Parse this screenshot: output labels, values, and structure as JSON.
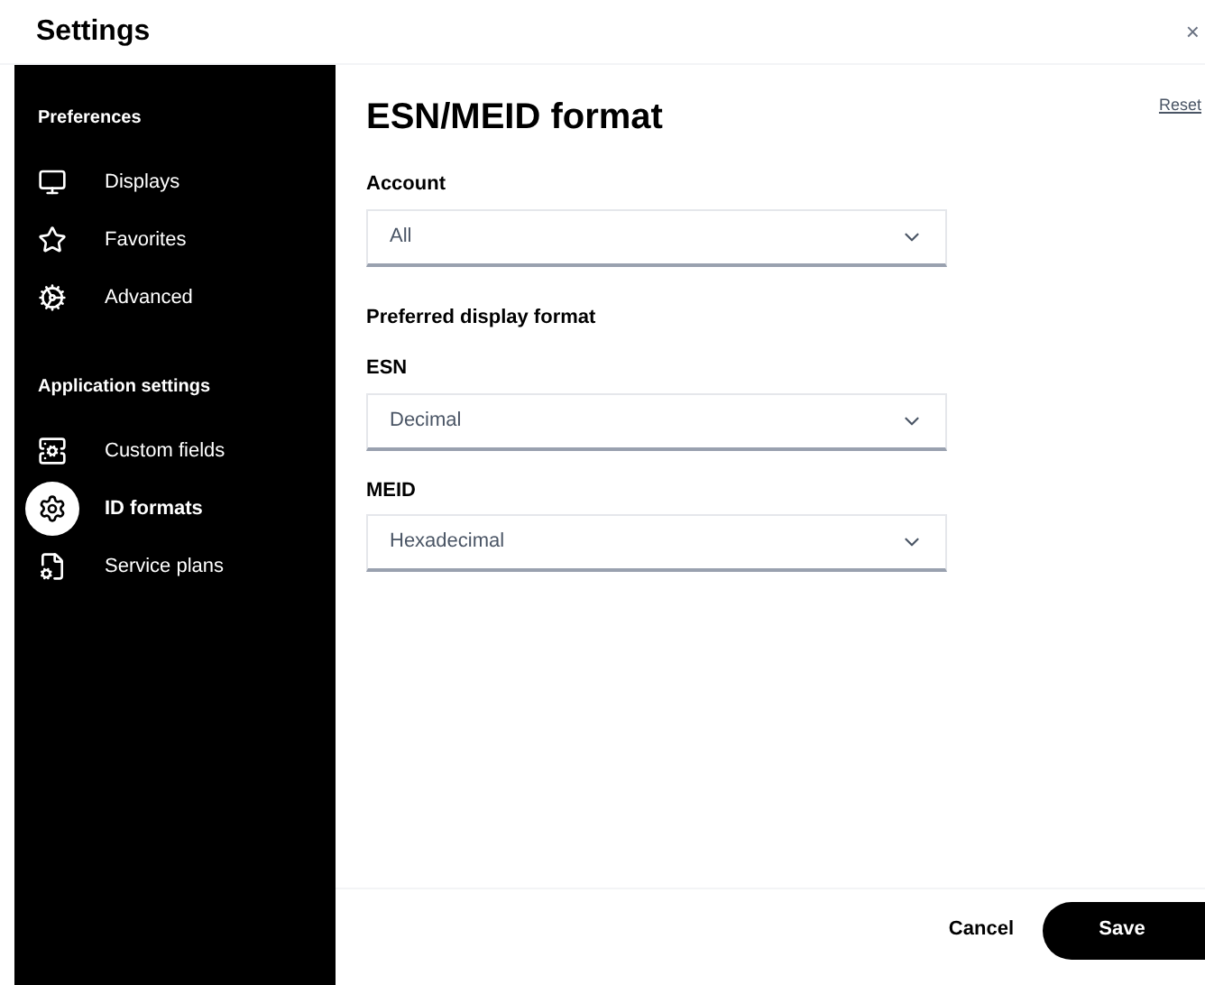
{
  "window": {
    "title": "Settings",
    "close": "×"
  },
  "sidebar": {
    "sections": [
      {
        "heading": "Preferences",
        "items": [
          {
            "label": "Displays",
            "selected": false
          },
          {
            "label": "Favorites",
            "selected": false
          },
          {
            "label": "Advanced",
            "selected": false
          }
        ]
      },
      {
        "heading": "Application settings",
        "items": [
          {
            "label": "Custom fields",
            "selected": false
          },
          {
            "label": "ID formats",
            "selected": true
          },
          {
            "label": "Service plans",
            "selected": false
          }
        ]
      }
    ]
  },
  "main": {
    "title": "ESN/MEID format",
    "reset": "Reset",
    "fields": [
      {
        "kind": "select",
        "label": "Account",
        "value": "All"
      },
      {
        "kind": "heading",
        "label": "Preferred display format"
      },
      {
        "kind": "select",
        "label": "ESN",
        "value": "Decimal"
      },
      {
        "kind": "select",
        "label": "MEID",
        "value": "Hexadecimal"
      }
    ]
  },
  "footer": {
    "cancel": "Cancel",
    "save": "Save"
  }
}
